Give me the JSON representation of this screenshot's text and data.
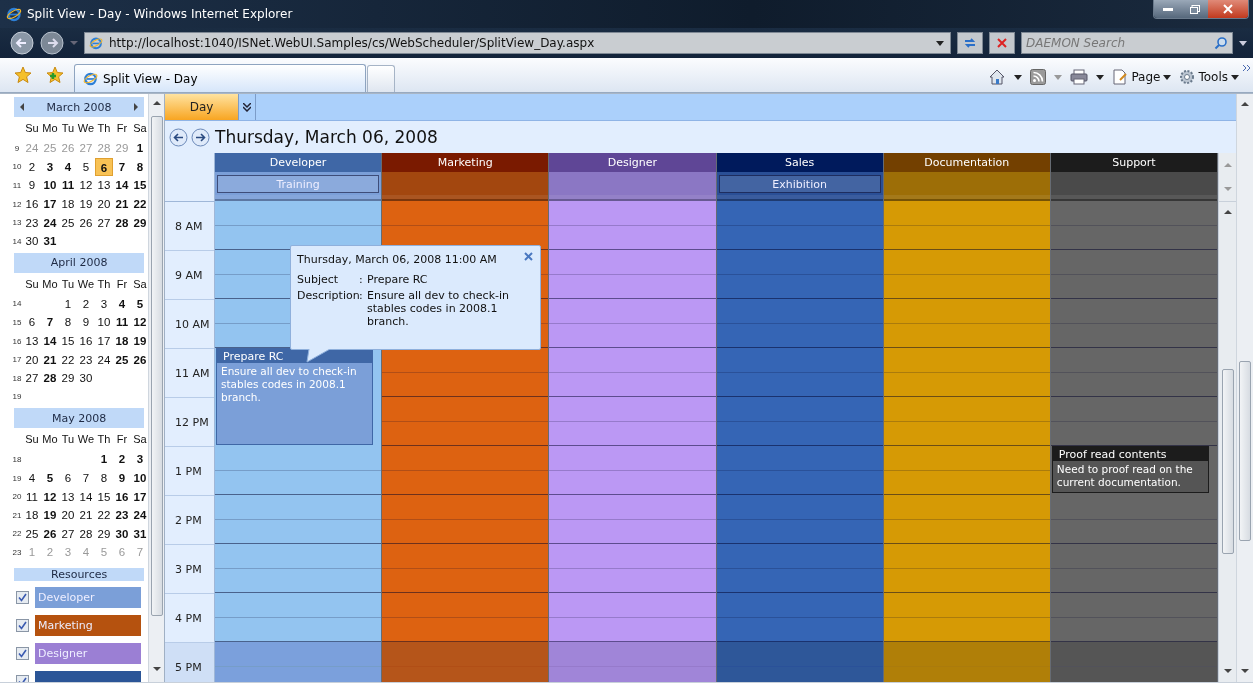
{
  "window": {
    "title": "Split View - Day - Windows Internet Explorer"
  },
  "address_bar": {
    "url": "http://localhost:1040/ISNet.WebUI.Samples/cs/WebScheduler/SplitView_Day.aspx"
  },
  "search": {
    "placeholder": "DAEMON Search"
  },
  "tabs": [
    {
      "label": "Split View - Day",
      "selected": true
    }
  ],
  "command_bar": [
    {
      "label": "Page"
    },
    {
      "label": "Tools"
    }
  ],
  "calendars": [
    {
      "title": "March 2008",
      "nav": true,
      "weekdays": [
        "Su",
        "Mo",
        "Tu",
        "We",
        "Th",
        "Fr",
        "Sa"
      ],
      "weeks": [
        {
          "week": "9",
          "days": [
            {
              "day": "24",
              "kind": "other",
              "selected": false
            },
            {
              "day": "25",
              "kind": "other",
              "selected": false
            },
            {
              "day": "26",
              "kind": "other",
              "selected": false
            },
            {
              "day": "27",
              "kind": "other",
              "selected": false
            },
            {
              "day": "28",
              "kind": "other",
              "selected": false
            },
            {
              "day": "29",
              "kind": "other",
              "selected": false
            },
            {
              "day": "1",
              "kind": "bold",
              "selected": false
            }
          ]
        },
        {
          "week": "10",
          "days": [
            {
              "day": "2",
              "kind": "plain",
              "selected": false
            },
            {
              "day": "3",
              "kind": "bold",
              "selected": false
            },
            {
              "day": "4",
              "kind": "bold",
              "selected": false
            },
            {
              "day": "5",
              "kind": "plain",
              "selected": false
            },
            {
              "day": "6",
              "kind": "bold",
              "selected": true
            },
            {
              "day": "7",
              "kind": "bold",
              "selected": false
            },
            {
              "day": "8",
              "kind": "bold",
              "selected": false
            }
          ]
        },
        {
          "week": "11",
          "days": [
            {
              "day": "9",
              "kind": "plain",
              "selected": false
            },
            {
              "day": "10",
              "kind": "bold",
              "selected": false
            },
            {
              "day": "11",
              "kind": "bold",
              "selected": false
            },
            {
              "day": "12",
              "kind": "plain",
              "selected": false
            },
            {
              "day": "13",
              "kind": "plain",
              "selected": false
            },
            {
              "day": "14",
              "kind": "bold",
              "selected": false
            },
            {
              "day": "15",
              "kind": "bold",
              "selected": false
            }
          ]
        },
        {
          "week": "12",
          "days": [
            {
              "day": "16",
              "kind": "plain",
              "selected": false
            },
            {
              "day": "17",
              "kind": "bold",
              "selected": false
            },
            {
              "day": "18",
              "kind": "plain",
              "selected": false
            },
            {
              "day": "19",
              "kind": "plain",
              "selected": false
            },
            {
              "day": "20",
              "kind": "plain",
              "selected": false
            },
            {
              "day": "21",
              "kind": "bold",
              "selected": false
            },
            {
              "day": "22",
              "kind": "bold",
              "selected": false
            }
          ]
        },
        {
          "week": "13",
          "days": [
            {
              "day": "23",
              "kind": "plain",
              "selected": false
            },
            {
              "day": "24",
              "kind": "bold",
              "selected": false
            },
            {
              "day": "25",
              "kind": "plain",
              "selected": false
            },
            {
              "day": "26",
              "kind": "plain",
              "selected": false
            },
            {
              "day": "27",
              "kind": "plain",
              "selected": false
            },
            {
              "day": "28",
              "kind": "bold",
              "selected": false
            },
            {
              "day": "29",
              "kind": "bold",
              "selected": false
            }
          ]
        },
        {
          "week": "14",
          "days": [
            {
              "day": "30",
              "kind": "plain",
              "selected": false
            },
            {
              "day": "31",
              "kind": "bold",
              "selected": false
            }
          ]
        }
      ]
    },
    {
      "title": "April 2008",
      "nav": false,
      "weekdays": [
        "Su",
        "Mo",
        "Tu",
        "We",
        "Th",
        "Fr",
        "Sa"
      ],
      "weeks": [
        {
          "week": "14",
          "days": [
            {
              "day": "1",
              "kind": "plain",
              "selected": false
            },
            {
              "day": "2",
              "kind": "plain",
              "selected": false
            },
            {
              "day": "3",
              "kind": "plain",
              "selected": false
            },
            {
              "day": "4",
              "kind": "bold",
              "selected": false
            },
            {
              "day": "5",
              "kind": "bold",
              "selected": false
            }
          ]
        },
        {
          "week": "15",
          "days": [
            {
              "day": "6",
              "kind": "plain",
              "selected": false
            },
            {
              "day": "7",
              "kind": "bold",
              "selected": false
            },
            {
              "day": "8",
              "kind": "plain",
              "selected": false
            },
            {
              "day": "9",
              "kind": "plain",
              "selected": false
            },
            {
              "day": "10",
              "kind": "plain",
              "selected": false
            },
            {
              "day": "11",
              "kind": "bold",
              "selected": false
            },
            {
              "day": "12",
              "kind": "bold",
              "selected": false
            }
          ]
        },
        {
          "week": "16",
          "days": [
            {
              "day": "13",
              "kind": "plain",
              "selected": false
            },
            {
              "day": "14",
              "kind": "bold",
              "selected": false
            },
            {
              "day": "15",
              "kind": "plain",
              "selected": false
            },
            {
              "day": "16",
              "kind": "plain",
              "selected": false
            },
            {
              "day": "17",
              "kind": "plain",
              "selected": false
            },
            {
              "day": "18",
              "kind": "bold",
              "selected": false
            },
            {
              "day": "19",
              "kind": "bold",
              "selected": false
            }
          ]
        },
        {
          "week": "17",
          "days": [
            {
              "day": "20",
              "kind": "plain",
              "selected": false
            },
            {
              "day": "21",
              "kind": "bold",
              "selected": false
            },
            {
              "day": "22",
              "kind": "plain",
              "selected": false
            },
            {
              "day": "23",
              "kind": "plain",
              "selected": false
            },
            {
              "day": "24",
              "kind": "plain",
              "selected": false
            },
            {
              "day": "25",
              "kind": "bold",
              "selected": false
            },
            {
              "day": "26",
              "kind": "bold",
              "selected": false
            }
          ]
        },
        {
          "week": "18",
          "days": [
            {
              "day": "27",
              "kind": "plain",
              "selected": false
            },
            {
              "day": "28",
              "kind": "bold",
              "selected": false
            },
            {
              "day": "29",
              "kind": "plain",
              "selected": false
            },
            {
              "day": "30",
              "kind": "plain",
              "selected": false
            }
          ]
        },
        {
          "week": "19"
        }
      ]
    },
    {
      "title": "May 2008",
      "nav": false,
      "weekdays": [
        "Su",
        "Mo",
        "Tu",
        "We",
        "Th",
        "Fr",
        "Sa"
      ],
      "weeks": [
        {
          "week": "18",
          "days": [
            {
              "day": "1",
              "kind": "bold",
              "selected": false
            },
            {
              "day": "2",
              "kind": "bold",
              "selected": false
            },
            {
              "day": "3",
              "kind": "bold",
              "selected": false
            }
          ]
        },
        {
          "week": "19",
          "days": [
            {
              "day": "4",
              "kind": "plain",
              "selected": false
            },
            {
              "day": "5",
              "kind": "bold",
              "selected": false
            },
            {
              "day": "6",
              "kind": "plain",
              "selected": false
            },
            {
              "day": "7",
              "kind": "plain",
              "selected": false
            },
            {
              "day": "8",
              "kind": "plain",
              "selected": false
            },
            {
              "day": "9",
              "kind": "bold",
              "selected": false
            },
            {
              "day": "10",
              "kind": "bold",
              "selected": false
            }
          ]
        },
        {
          "week": "20",
          "days": [
            {
              "day": "11",
              "kind": "plain",
              "selected": false
            },
            {
              "day": "12",
              "kind": "bold",
              "selected": false
            },
            {
              "day": "13",
              "kind": "plain",
              "selected": false
            },
            {
              "day": "14",
              "kind": "plain",
              "selected": false
            },
            {
              "day": "15",
              "kind": "plain",
              "selected": false
            },
            {
              "day": "16",
              "kind": "bold",
              "selected": false
            },
            {
              "day": "17",
              "kind": "bold",
              "selected": false
            }
          ]
        },
        {
          "week": "21",
          "days": [
            {
              "day": "18",
              "kind": "plain",
              "selected": false
            },
            {
              "day": "19",
              "kind": "bold",
              "selected": false
            },
            {
              "day": "20",
              "kind": "plain",
              "selected": false
            },
            {
              "day": "21",
              "kind": "plain",
              "selected": false
            },
            {
              "day": "22",
              "kind": "plain",
              "selected": false
            },
            {
              "day": "23",
              "kind": "bold",
              "selected": false
            },
            {
              "day": "24",
              "kind": "bold",
              "selected": false
            }
          ]
        },
        {
          "week": "22",
          "days": [
            {
              "day": "25",
              "kind": "plain",
              "selected": false
            },
            {
              "day": "26",
              "kind": "bold",
              "selected": false
            },
            {
              "day": "27",
              "kind": "plain",
              "selected": false
            },
            {
              "day": "28",
              "kind": "plain",
              "selected": false
            },
            {
              "day": "29",
              "kind": "plain",
              "selected": false
            },
            {
              "day": "30",
              "kind": "bold",
              "selected": false
            },
            {
              "day": "31",
              "kind": "bold",
              "selected": false
            }
          ]
        },
        {
          "week": "23",
          "days": [
            {
              "day": "1",
              "kind": "other",
              "selected": false
            },
            {
              "day": "2",
              "kind": "other",
              "selected": false
            },
            {
              "day": "3",
              "kind": "other",
              "selected": false
            },
            {
              "day": "4",
              "kind": "other",
              "selected": false
            },
            {
              "day": "5",
              "kind": "other",
              "selected": false
            },
            {
              "day": "6",
              "kind": "other",
              "selected": false
            },
            {
              "day": "7",
              "kind": "other",
              "selected": false
            }
          ]
        }
      ]
    }
  ],
  "resources": {
    "title": "Resources",
    "items": [
      {
        "label": "Developer",
        "checked": true,
        "color": "#7b9fd8"
      },
      {
        "label": "Marketing",
        "checked": true,
        "color": "#b5520f"
      },
      {
        "label": "Designer",
        "checked": true,
        "color": "#9b7fd4"
      },
      {
        "checked": true,
        "color": "#2b5597"
      }
    ]
  },
  "scheduler": {
    "views": [
      {
        "label": "Day",
        "selected": true
      }
    ],
    "date_title": "Thursday, March 06, 2008",
    "hours": [
      {
        "label": "8 AM",
        "working": true
      },
      {
        "label": "9 AM",
        "working": true
      },
      {
        "label": "10 AM",
        "working": true
      },
      {
        "label": "11 AM",
        "working": true
      },
      {
        "label": "12 PM",
        "working": true
      },
      {
        "label": "1 PM",
        "working": true
      },
      {
        "label": "2 PM",
        "working": true
      },
      {
        "label": "3 PM",
        "working": true
      },
      {
        "label": "4 PM",
        "working": true
      },
      {
        "label": "5 PM",
        "working": false
      }
    ],
    "columns": [
      {
        "name": "Developer",
        "header": {
          "color": "#3f67a6"
        },
        "band": {
          "color": "#7b9fd8",
          "event": "Training"
        },
        "color": "#93c4f0",
        "off_hours": {
          "color": "#7ba0dc"
        },
        "slots": [
          {
            "kind": "free"
          },
          {
            "kind": "free"
          },
          {
            "kind": "free"
          },
          {
            "kind": "event",
            "title": "Prepare RC",
            "description": "Ensure all dev to check-in stables codes in 2008.1 branch."
          },
          {
            "kind": "continued"
          }
        ]
      },
      {
        "name": "Marketing",
        "header": {
          "color": "#7a1a00"
        },
        "band": {
          "color": "#a3470f"
        },
        "color": "#dd6211",
        "off_hours": {
          "color": "#b5551a"
        }
      },
      {
        "name": "Designer",
        "header": {
          "color": "#5f4696"
        },
        "band": {
          "color": "#8b77c4"
        },
        "color": "#bb98f4",
        "off_hours": {
          "color": "#a085d8"
        }
      },
      {
        "name": "Sales",
        "header": {
          "color": "#001a5c"
        },
        "band": {
          "color": "#2a4f96",
          "event": "Exhibition"
        },
        "color": "#3565b5",
        "off_hours": {
          "color": "#2e5799"
        }
      },
      {
        "name": "Documentation",
        "header": {
          "color": "#734000"
        },
        "band": {
          "color": "#9d6e07"
        },
        "color": "#d69a05",
        "off_hours": {
          "color": "#b07f08"
        }
      },
      {
        "name": "Support",
        "header": {
          "color": "#1c1c1c"
        },
        "band": {
          "color": "#4a4a4a"
        },
        "color": "#666666",
        "off_hours": {
          "color": "#555555"
        },
        "slots": [
          {
            "kind": "free"
          },
          {
            "kind": "free"
          },
          {
            "kind": "free"
          },
          {
            "kind": "free"
          },
          {
            "kind": "free"
          },
          {
            "kind": "event",
            "title": "Proof read contents",
            "description": "Need to proof read on the current documentation."
          }
        ]
      }
    ],
    "tooltip": {
      "title": "Thursday, March 06, 2008 11:00 AM",
      "fields": [
        {
          "label": "Subject",
          "separator": ":",
          "value": "Prepare RC"
        },
        {
          "label": "Description",
          "separator": ":",
          "value": "Ensure all dev to check-in stables codes in 2008.1 branch."
        }
      ]
    }
  }
}
